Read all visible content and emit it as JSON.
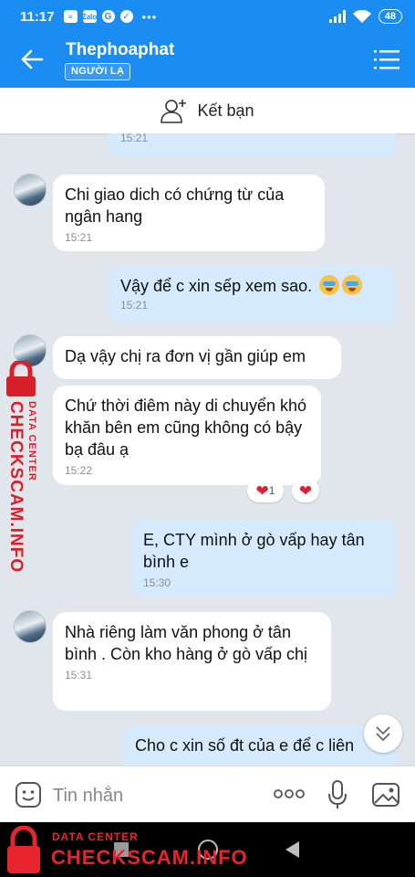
{
  "status_bar": {
    "time": "11:17",
    "notif_icons": [
      "message-icon",
      "zalo-icon",
      "google-icon",
      "check-icon"
    ],
    "zalo_label": "Zalo",
    "google_letter": "G",
    "more_dots": "•••",
    "battery": "48"
  },
  "header": {
    "title": "Thephoaphat",
    "badge": "NGƯỜI LẠ"
  },
  "add_friend": {
    "label": "Kết bạn"
  },
  "messages": [
    {
      "dir": "out",
      "text": "",
      "time": "15:21",
      "partial": true
    },
    {
      "dir": "in",
      "avatar": true,
      "text": "Chi giao dich có chứng từ của ngân hang",
      "time": "15:21"
    },
    {
      "dir": "out",
      "text": "Vậy để c xin sếp xem sao.",
      "time": "15:21",
      "emoji_count": 2
    },
    {
      "dir": "in",
      "avatar": true,
      "text": "Dạ vậy chị ra đơn vị gần giúp em",
      "time": ""
    },
    {
      "dir": "in",
      "text": "Chứ thời điêm này di chuyển khó khăn bên em cũng không có bậy bạ đâu ạ",
      "time": "15:22",
      "reaction_count": "1"
    },
    {
      "dir": "out",
      "text": "E, CTY mình ở gò vấp hay tân bình e",
      "time": "15:30"
    },
    {
      "dir": "in",
      "avatar": true,
      "text": "Nhà riêng làm văn phong ở tân bình . Còn kho hàng ở gò vấp chị",
      "time": "15:31"
    },
    {
      "dir": "out",
      "text": "Cho c xin số đt của e để c liên",
      "time": "",
      "partial": true
    }
  ],
  "input": {
    "placeholder": "Tin nhắn"
  },
  "watermark": {
    "top": "DATA CENTER",
    "brand": "CHECKSCAM.INFO",
    "color": "#e8242e"
  },
  "colors": {
    "accent": "#1b8df2",
    "outgoing": "#d5eafd",
    "heart": "#e0203a"
  }
}
